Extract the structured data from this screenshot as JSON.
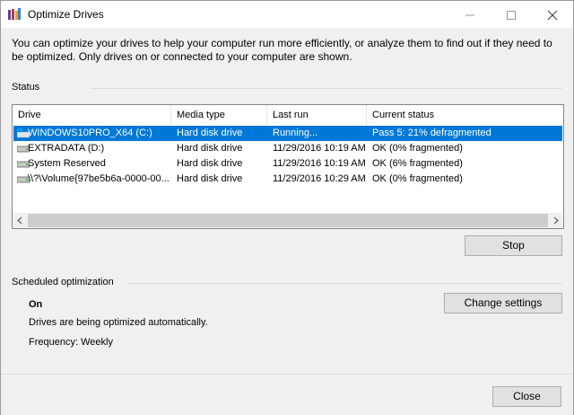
{
  "window": {
    "title": "Optimize Drives"
  },
  "description": "You can optimize your drives to help your computer run more efficiently, or analyze them to find out if they need to be optimized. Only drives on or connected to your computer are shown.",
  "status": {
    "label": "Status",
    "columns": [
      "Drive",
      "Media type",
      "Last run",
      "Current status"
    ],
    "drives": [
      {
        "name": "WINDOWS10PRO_X64 (C:)",
        "media": "Hard disk drive",
        "last_run": "Running...",
        "status": "Pass 5: 21% defragmented",
        "icon": "windows-drive-icon",
        "selected": true
      },
      {
        "name": "EXTRADATA (D:)",
        "media": "Hard disk drive",
        "last_run": "11/29/2016 10:19 AM",
        "status": "OK (0% fragmented)",
        "icon": "hard-drive-icon",
        "selected": false
      },
      {
        "name": "System Reserved",
        "media": "Hard disk drive",
        "last_run": "11/29/2016 10:19 AM",
        "status": "OK (6% fragmented)",
        "icon": "hard-drive-icon",
        "selected": false
      },
      {
        "name": "\\\\?\\Volume{97be5b6a-0000-00...",
        "media": "Hard disk drive",
        "last_run": "11/29/2016 10:29 AM",
        "status": "OK (0% fragmented)",
        "icon": "hard-drive-icon",
        "selected": false
      }
    ]
  },
  "buttons": {
    "stop": "Stop",
    "change_settings": "Change settings",
    "close": "Close"
  },
  "scheduled": {
    "label": "Scheduled optimization",
    "state": "On",
    "message": "Drives are being optimized automatically.",
    "frequency": "Frequency: Weekly"
  },
  "colors": {
    "selection": "#0078d7",
    "window_bg": "#f0f0f0"
  }
}
